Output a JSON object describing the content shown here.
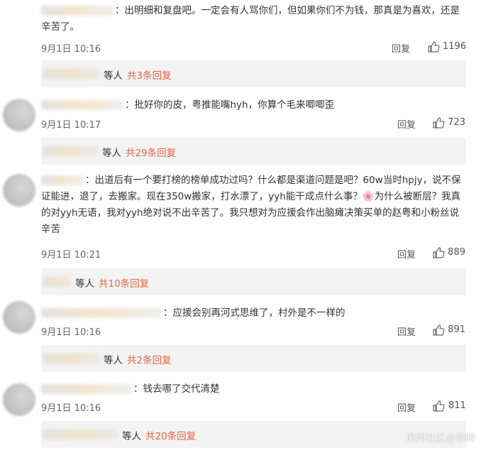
{
  "comments": [
    {
      "text": "：出明细和复盘吧。一定会有人骂你们，但如果你们不为钱，那真是为喜欢，还是辛苦了。",
      "time": "9月1日 10:16",
      "reply_label": "回复",
      "likes": "1196",
      "sub_who": "等人",
      "sub_total": "共3条回复"
    },
    {
      "text": "：批好你的皮，粤推能嘴hyh，你算个毛来唧唧歪",
      "time": "9月1日 10:17",
      "reply_label": "回复",
      "likes": "723",
      "sub_who": "等人",
      "sub_total": "共29条回复"
    },
    {
      "text": "：出道后有一个要打榜的榜单成功过吗？什么都是渠道问题是吧？60w当时hpjy，说不保证能进，退了，去搬家。现在350w搬家，打水漂了，yyh能干成点什么事？🌸为什么被断层？我真的对yyh无语，我对yyh绝对说不出辛苦了。我只想对为应援会作出脑瘫决策买单的赵粤和小粉丝说辛苦",
      "time": "9月1日 10:21",
      "reply_label": "回复",
      "likes": "889",
      "sub_who": "等人",
      "sub_total": "共10条回复"
    },
    {
      "text": "：应援会别再河式思维了，村外是不一样的",
      "time": "9月1日 10:16",
      "reply_label": "回复",
      "likes": "891",
      "sub_who": "等人",
      "sub_total": "共2条回复"
    },
    {
      "text": "：钱去哪了交代清楚",
      "time": "9月1日 10:16",
      "reply_label": "回复",
      "likes": "811",
      "sub_who": "等人",
      "sub_total": "共20条回复"
    }
  ],
  "watermark": "风闻社区@毒眸",
  "colors": {
    "accent": "#e8633e",
    "sub_bg": "#f3f3f3"
  }
}
